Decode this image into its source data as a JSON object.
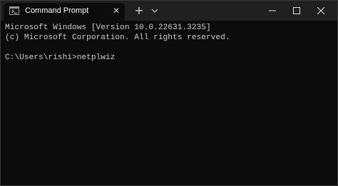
{
  "titlebar": {
    "tab_title": "Command Prompt",
    "tab_icon": "cmd-terminal-icon",
    "tab_close_icon": "close-icon",
    "new_tab_icon": "plus-icon",
    "dropdown_icon": "chevron-down-icon",
    "minimize_icon": "minimize-icon",
    "maximize_icon": "maximize-icon",
    "close_icon": "close-icon"
  },
  "console": {
    "lines": [
      "Microsoft Windows [Version 10.0.22631.3235]",
      "(c) Microsoft Corporation. All rights reserved.",
      "",
      "C:\\Users\\rishi>netplwiz"
    ]
  },
  "colors": {
    "background": "#0c0c0c",
    "titlebar": "#202020",
    "text": "#cccccc"
  }
}
